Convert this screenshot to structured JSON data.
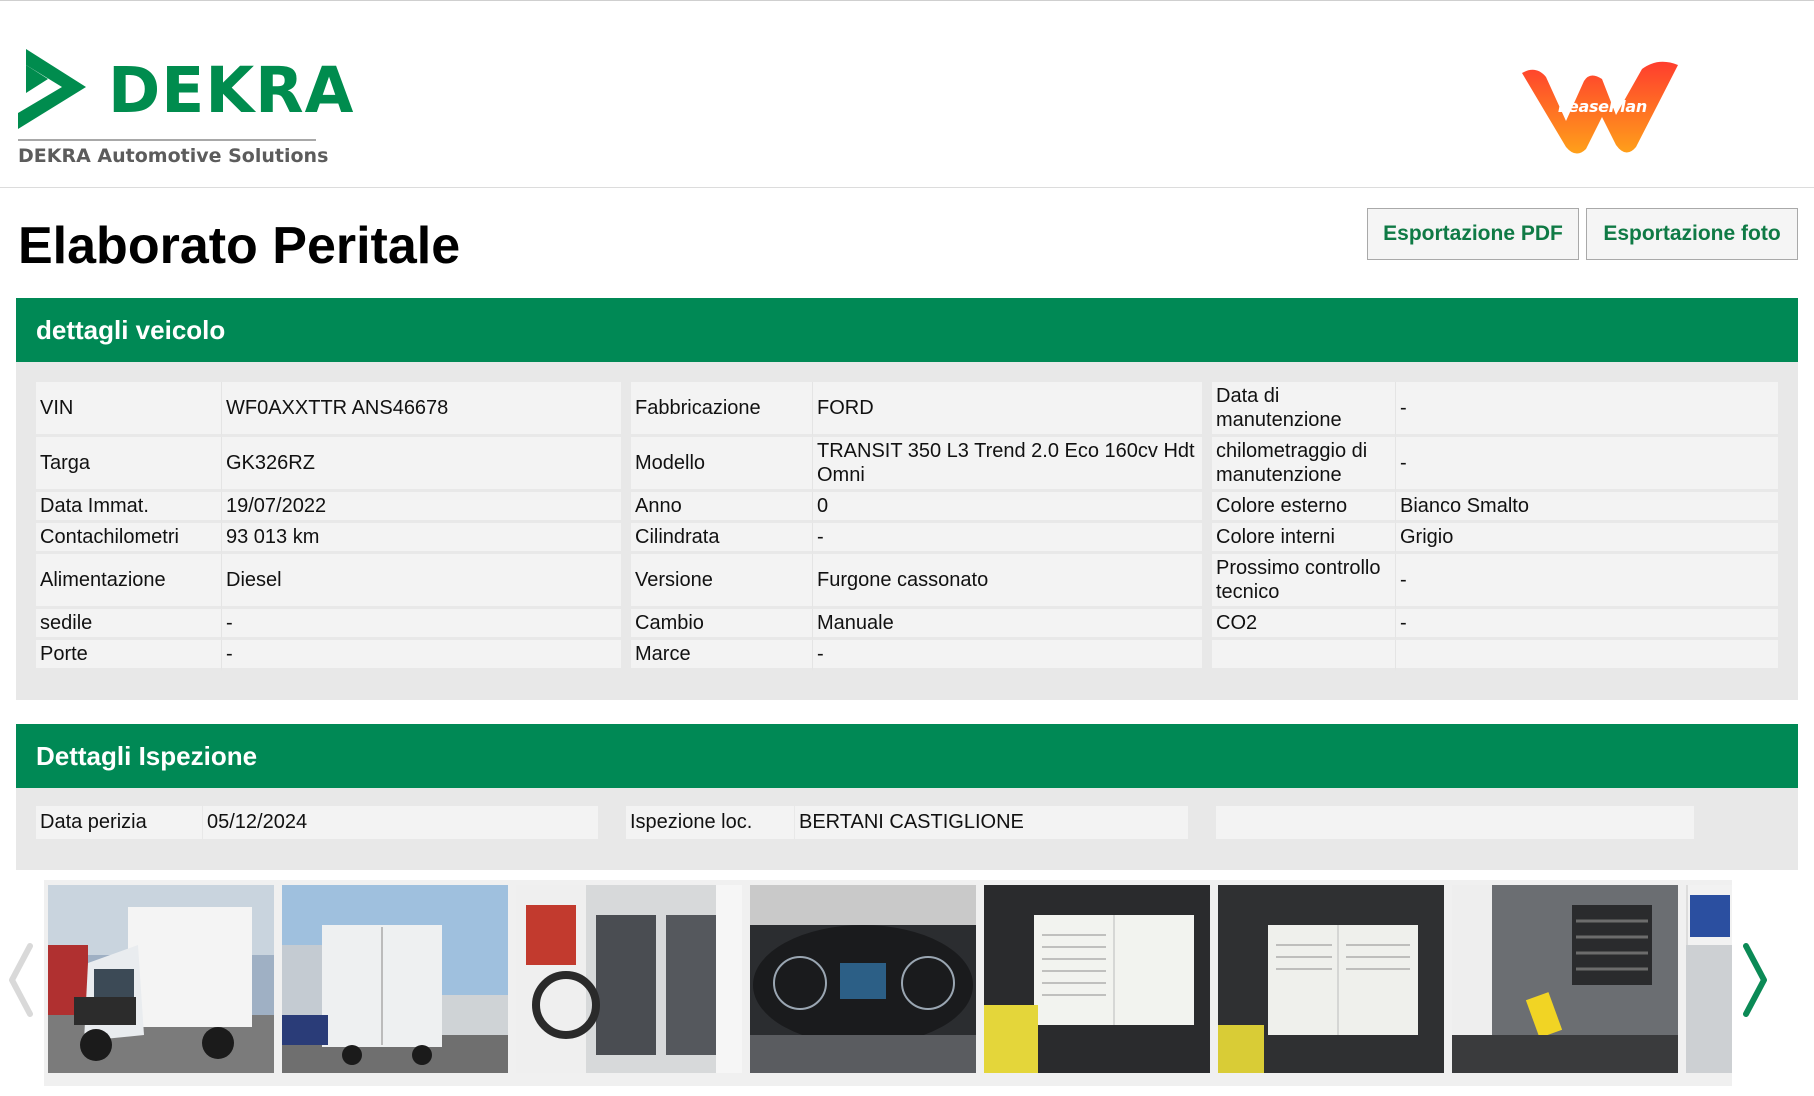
{
  "header": {
    "brand": "DEKRA",
    "brand_subtitle": "DEKRA Automotive Solutions",
    "partner_logo_text": "LeasePlan",
    "colors": {
      "dekra_green": "#008c4e",
      "leaseplan_orange": "#f26b21"
    }
  },
  "page": {
    "title": "Elaborato Peritale",
    "export_pdf": "Esportazione PDF",
    "export_photos": "Esportazione foto"
  },
  "vehicle": {
    "section_title": "dettagli veicolo",
    "rows": [
      [
        {
          "label": "VIN",
          "value": "WF0AXXTTR ANS46678"
        },
        {
          "label": "Fabbricazione",
          "value": "FORD"
        },
        {
          "label": "Data di manutenzione",
          "value": "-"
        }
      ],
      [
        {
          "label": "Targa",
          "value": "GK326RZ"
        },
        {
          "label": "Modello",
          "value": "TRANSIT 350 L3 Trend 2.0 Eco 160cv Hdt Omni"
        },
        {
          "label": "chilometraggio di manutenzione",
          "value": "-"
        }
      ],
      [
        {
          "label": "Data Immat.",
          "value": "19/07/2022"
        },
        {
          "label": "Anno",
          "value": "0"
        },
        {
          "label": "Colore esterno",
          "value": "Bianco Smalto"
        }
      ],
      [
        {
          "label": "Contachilometri",
          "value": "93 013 km"
        },
        {
          "label": "Cilindrata",
          "value": "-"
        },
        {
          "label": "Colore interni",
          "value": "Grigio"
        }
      ],
      [
        {
          "label": "Alimentazione",
          "value": "Diesel"
        },
        {
          "label": "Versione",
          "value": "Furgone cassonato"
        },
        {
          "label": "Prossimo controllo tecnico",
          "value": "-"
        }
      ],
      [
        {
          "label": "sedile",
          "value": "-"
        },
        {
          "label": "Cambio",
          "value": "Manuale"
        },
        {
          "label": "CO2",
          "value": "-"
        }
      ],
      [
        {
          "label": "Porte",
          "value": "-"
        },
        {
          "label": "Marce",
          "value": "-"
        },
        {
          "label": "",
          "value": ""
        }
      ]
    ]
  },
  "inspection": {
    "section_title": "Dettagli Ispezione",
    "date_label": "Data perizia",
    "date_value": "05/12/2024",
    "location_label": "Ispezione loc.",
    "location_value": "BERTANI CASTIGLIONE"
  },
  "gallery": {
    "thumbnails": [
      "van-front-photo",
      "van-rear-photo",
      "cabin-seats-photo",
      "dashboard-photo",
      "document-on-seat-photo",
      "document-on-seat-photo-2",
      "keys-vent-photo",
      "license-plate-photo"
    ],
    "prev_icon": "chevron-left-icon",
    "next_icon": "chevron-right-icon"
  }
}
